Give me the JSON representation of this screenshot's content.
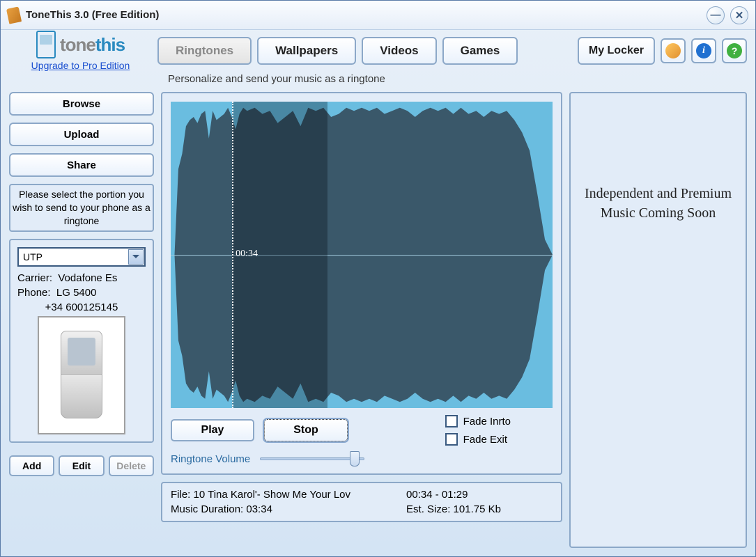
{
  "window": {
    "title": "ToneThis 3.0 (Free Edition)"
  },
  "logo": {
    "brand1": "tone",
    "brand2": "this",
    "upgrade": "Upgrade to Pro Edition"
  },
  "tabs": {
    "ringtones": "Ringtones",
    "wallpapers": "Wallpapers",
    "videos": "Videos",
    "games": "Games",
    "mylocker": "My Locker"
  },
  "subtitle": "Personalize and send your music as a ringtone",
  "sidebar": {
    "browse": "Browse",
    "upload": "Upload",
    "share": "Share",
    "instruction": "Please select the portion you wish to send to your phone as a ringtone",
    "profile_selected": "UTP",
    "carrier_label": "Carrier:",
    "carrier_value": "Vodafone Es",
    "phone_label": "Phone:",
    "phone_value": "LG 5400",
    "phone_number": "+34 600125145",
    "add": "Add",
    "edit": "Edit",
    "delete": "Delete"
  },
  "player": {
    "playhead_time": "00:34",
    "play": "Play",
    "stop": "Stop",
    "volume_label": "Ringtone Volume",
    "fade_intro": "Fade Inrto",
    "fade_exit": "Fade Exit",
    "selection_start": "00:34",
    "selection_end": "01:29",
    "selection_start_frac": 0.16,
    "selection_end_frac": 0.41,
    "volume_value": 0.95
  },
  "fileinfo": {
    "file_label": "File:",
    "file_name": "10 Tina Karol'- Show Me Your Lov",
    "duration_label": "Music Duration:",
    "duration_value": "03:34",
    "range": "00:34 - 01:29",
    "size_label": "Est. Size:",
    "size_value": "101.75 Kb"
  },
  "right": {
    "text": "Independent and Premium Music Coming Soon"
  }
}
